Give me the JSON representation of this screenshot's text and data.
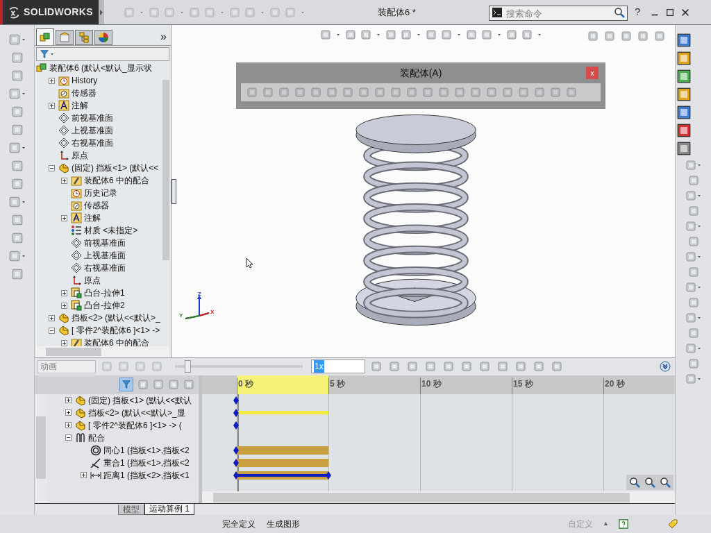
{
  "app": {
    "logo": "SOLIDWORKS",
    "title": "装配体6 *",
    "search": {
      "placeholder": "搜索命令"
    },
    "help": "?"
  },
  "feature_tree": {
    "tabs": [
      {
        "selected": true
      },
      {
        "selected": false
      },
      {
        "selected": false
      },
      {
        "selected": false
      }
    ],
    "more": "»",
    "root": {
      "label": "装配体6  (默认<默认_显示状",
      "kind": "assembly",
      "children": [
        {
          "label": "History",
          "kind": "history",
          "expanded": false
        },
        {
          "label": "传感器",
          "kind": "sensor"
        },
        {
          "label": "注解",
          "kind": "annotation",
          "expanded": false
        },
        {
          "label": "前视基准面",
          "kind": "plane"
        },
        {
          "label": "上视基准面",
          "kind": "plane"
        },
        {
          "label": "右视基准面",
          "kind": "plane"
        },
        {
          "label": "原点",
          "kind": "origin"
        },
        {
          "label": "(固定) 挡板<1>  (默认<<",
          "kind": "part",
          "expanded": true,
          "children": [
            {
              "label": "装配体6 中的配合",
              "kind": "mates",
              "expanded": false
            },
            {
              "label": "历史记录",
              "kind": "history"
            },
            {
              "label": "传感器",
              "kind": "sensor"
            },
            {
              "label": "注解",
              "kind": "annotation",
              "expanded": false
            },
            {
              "label": "材质 <未指定>",
              "kind": "material"
            },
            {
              "label": "前视基准面",
              "kind": "plane"
            },
            {
              "label": "上视基准面",
              "kind": "plane"
            },
            {
              "label": "右视基准面",
              "kind": "plane"
            },
            {
              "label": "原点",
              "kind": "origin"
            },
            {
              "label": "凸台-拉伸1",
              "kind": "extrude",
              "expanded": false
            },
            {
              "label": "凸台-拉伸2",
              "kind": "extrude",
              "expanded": false
            }
          ]
        },
        {
          "label": "挡板<2>  (默认<<默认>_",
          "kind": "part",
          "expanded": false
        },
        {
          "label": "[ 零件2^装配体6 ]<1>  ->",
          "kind": "part",
          "expanded": true,
          "children": [
            {
              "label": "装配体6 中的配合",
              "kind": "mates",
              "expanded": false
            }
          ]
        }
      ]
    }
  },
  "floating_toolbar": {
    "title": "装配体(A)",
    "close": "x"
  },
  "triad": {
    "x": "X",
    "y": "Y",
    "z": "Z"
  },
  "motion": {
    "study_type": "动画",
    "speed": "1x",
    "slider": {
      "level": 0.08
    },
    "ruler": [
      "0 秒",
      "5 秒",
      "10 秒",
      "15 秒",
      "20 秒"
    ],
    "rows": [
      {
        "label": "(固定) 挡板<1>  (默认<<默认",
        "kind": "part",
        "expanded": false
      },
      {
        "label": "挡板<2>  (默认<<默认>_显",
        "kind": "part",
        "expanded": false
      },
      {
        "label": "[ 零件2^装配体6 ]<1>  ->  (",
        "kind": "part",
        "expanded": false
      },
      {
        "label": "配合",
        "kind": "mategroup",
        "expanded": true,
        "children": [
          {
            "label": "同心1 (挡板<1>,挡板<2",
            "kind": "concentric"
          },
          {
            "label": "重合1 (挡板<1>,挡板<2",
            "kind": "coincident"
          },
          {
            "label": "距离1 (挡板<2>,挡板<1",
            "kind": "distance",
            "expanded": false
          }
        ]
      }
    ],
    "tracks": [
      {
        "kind": "key"
      },
      {
        "kind": "change"
      },
      {
        "kind": "key"
      },
      {
        "kind": "none"
      },
      {
        "kind": "mate"
      },
      {
        "kind": "mate"
      },
      {
        "kind": "driven"
      }
    ],
    "tabs": [
      {
        "label": "模型",
        "selected": false
      },
      {
        "label": "运动算例 1",
        "selected": true
      }
    ]
  },
  "status_bar": {
    "items": [
      "完全定义",
      "生成图形"
    ],
    "custom": "自定义",
    "arrow": "▲"
  }
}
